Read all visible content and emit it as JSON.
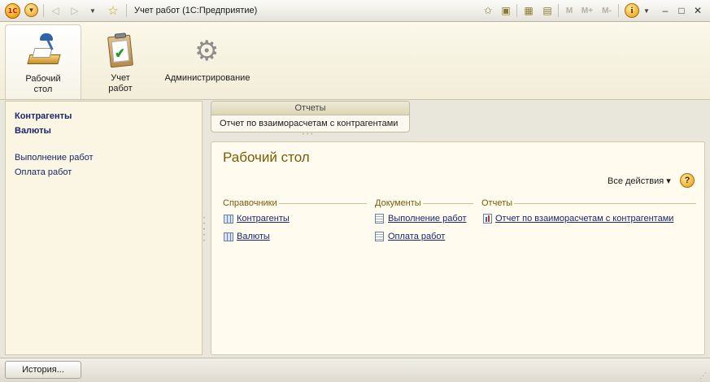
{
  "titlebar": {
    "title": "Учет работ  (1С:Предприятие)",
    "logo_text": "1С",
    "mem_m": "M",
    "mem_mplus": "M+",
    "mem_mminus": "M-",
    "info_text": "i",
    "minimize": "–",
    "maximize": "□",
    "close": "✕"
  },
  "sections": [
    {
      "label": "Рабочий стол",
      "icon": "desk-icon",
      "active": true
    },
    {
      "label": "Учет работ",
      "icon": "clipboard-icon",
      "active": false
    },
    {
      "label": "Администрирование",
      "icon": "gear-icon",
      "active": false
    }
  ],
  "left_nav": {
    "items": [
      {
        "label": "Контрагенты",
        "bold": true
      },
      {
        "label": "Валюты",
        "bold": true
      },
      {
        "label": "Выполнение работ",
        "bold": false
      },
      {
        "label": "Оплата работ",
        "bold": false
      }
    ]
  },
  "reports_panel": {
    "title": "Отчеты",
    "items": [
      "Отчет по взаиморасчетам с контрагентами"
    ]
  },
  "work_area": {
    "title": "Рабочий стол",
    "all_actions": "Все действия ▾",
    "help": "?",
    "columns": [
      {
        "header": "Справочники",
        "items": [
          "Контрагенты",
          "Валюты"
        ],
        "icon": "catalog-icon"
      },
      {
        "header": "Документы",
        "items": [
          "Выполнение работ",
          "Оплата работ"
        ],
        "icon": "document-icon"
      },
      {
        "header": "Отчеты",
        "items": [
          "Отчет по взаиморасчетам с контрагентами"
        ],
        "icon": "report-icon"
      }
    ]
  },
  "statusbar": {
    "history_button": "История..."
  },
  "colors": {
    "accent_text": "#7a5b05",
    "link": "#17266b",
    "panel_bg": "#faf6e3"
  }
}
